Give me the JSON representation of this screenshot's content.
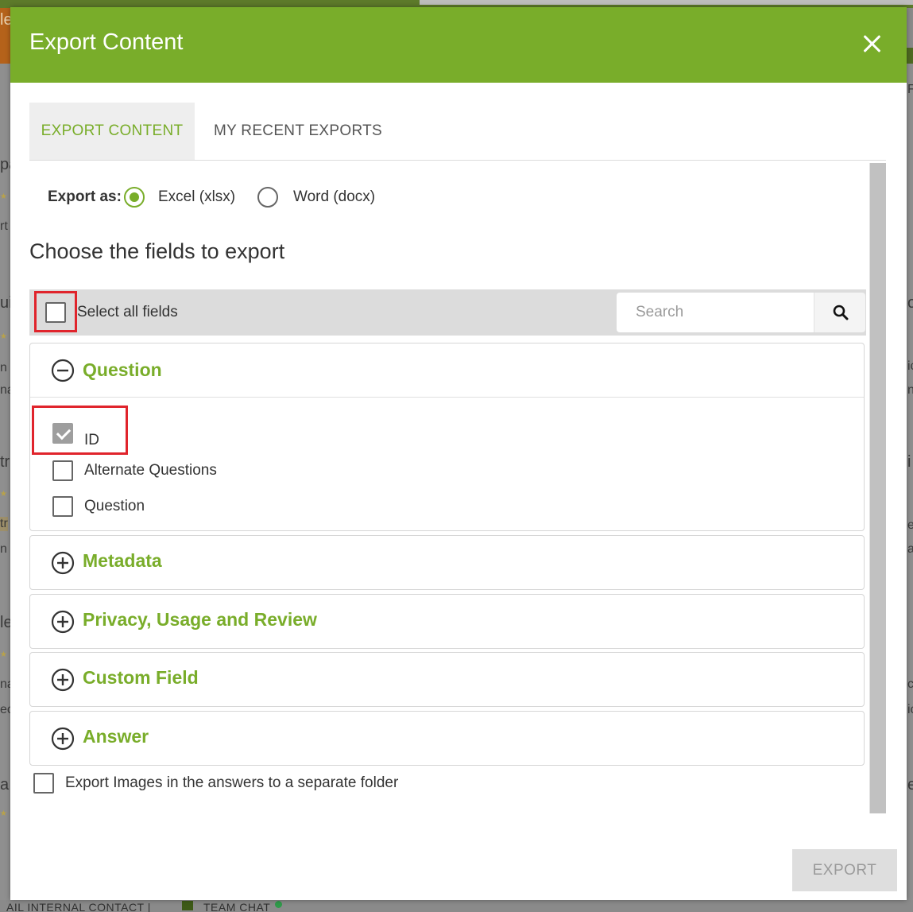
{
  "background": {
    "bottom_bar_text": "AIL INTERNAL CONTACT   |",
    "team_chat_label": "TEAM CHAT",
    "fragments_left": [
      "le",
      "pa",
      "rt",
      "ui",
      "n",
      "na",
      "tr",
      "tr",
      "n l",
      "le",
      "na",
      "ec",
      "a"
    ],
    "fragments_right": [
      "F",
      "o",
      "ic",
      "n",
      "i",
      "e",
      "at",
      "c",
      "ic",
      "e"
    ]
  },
  "modal": {
    "title": "Export Content",
    "close_icon": "close-icon",
    "header_color": "#79AD2A",
    "tabs": [
      {
        "label": "EXPORT CONTENT",
        "active": true
      },
      {
        "label": "MY RECENT EXPORTS",
        "active": false
      }
    ],
    "export_as": {
      "label": "Export as:",
      "options": [
        {
          "label": "Excel (xlsx)",
          "selected": true
        },
        {
          "label": "Word (docx)",
          "selected": false
        }
      ]
    },
    "fields_heading": "Choose the fields to export",
    "select_all": {
      "label": "Select all fields",
      "checked": false
    },
    "search": {
      "placeholder": "Search",
      "value": "",
      "icon": "search-icon"
    },
    "groups": [
      {
        "title": "Question",
        "expanded": true,
        "icon": "minus-circle-icon",
        "fields": [
          {
            "label": "ID",
            "checked": true,
            "disabled": true
          },
          {
            "label": "Alternate Questions",
            "checked": false
          },
          {
            "label": "Question",
            "checked": false
          }
        ]
      },
      {
        "title": "Metadata",
        "expanded": false,
        "icon": "plus-circle-icon"
      },
      {
        "title": "Privacy, Usage and Review",
        "expanded": false,
        "icon": "plus-circle-icon"
      },
      {
        "title": "Custom Field",
        "expanded": false,
        "icon": "plus-circle-icon"
      },
      {
        "title": "Answer",
        "expanded": false,
        "icon": "plus-circle-icon"
      }
    ],
    "export_images": {
      "label": "Export Images in the answers to a separate folder",
      "checked": false
    },
    "export_button": {
      "label": "EXPORT",
      "enabled": false
    },
    "accent_color": "#79AD2A",
    "highlight_color": "#E0242C"
  }
}
